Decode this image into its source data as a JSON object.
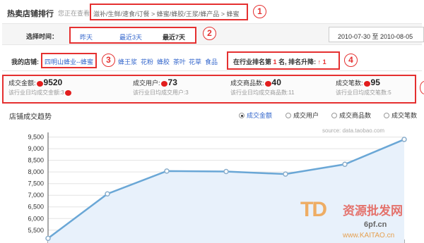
{
  "header": {
    "title": "热卖店铺排行",
    "lead": "您正在查看",
    "breadcrumb": "滋补/生鲜/速食/订餐 > 蜂蜜/蜂胶/王浆/蜂产品 > 蜂蜜"
  },
  "time_bar": {
    "label": "选择时间：",
    "options": [
      "昨天",
      "最近3天",
      "最近7天"
    ],
    "selected": "最近7天",
    "range_text": "2010-07-30 至  2010-08-05"
  },
  "categories": {
    "label": "我的店铺:",
    "shop": "四明山蜂业--蜂蜜",
    "items": [
      "蜂王浆",
      "花粉",
      "蜂胶",
      "茶叶",
      "花草",
      "食品"
    ],
    "rank_prefix": "在行业排名第",
    "rank": "1",
    "rank_mid": "名, 排名升降:",
    "rank_change": "↑ 1"
  },
  "stats": [
    {
      "label": "成交金额:",
      "value": "9520",
      "sub": "该行业日均成交金额:3"
    },
    {
      "label": "成交用户:",
      "value": "73",
      "sub": "该行业日均成交用户:3"
    },
    {
      "label": "成交商品数:",
      "value": "40",
      "sub": "该行业日均成交商品数:11"
    },
    {
      "label": "成交笔数:",
      "value": "95",
      "sub": "该行业日均成交笔数:5"
    }
  ],
  "trend": {
    "title": "店铺成交趋势",
    "options": [
      "成交金额",
      "成交用户",
      "成交商品数",
      "成交笔数"
    ],
    "selected": "成交金额",
    "source": "source: data.taobao.com"
  },
  "annotations": [
    "1",
    "2",
    "3",
    "4"
  ],
  "watermark": {
    "logo": "TD",
    "text": "资源批发网",
    "url1": "6pf.cn",
    "url2": "www.KAITAO.cn"
  },
  "colors": {
    "accent_red": "#e53030",
    "link_blue": "#3366cc",
    "series": "#6aa7d6",
    "fill": "#e8f1fb"
  },
  "chart_data": {
    "type": "area",
    "x": [
      1,
      2,
      3,
      4,
      5,
      6,
      7
    ],
    "series": [
      {
        "values": [
          5150,
          7060,
          8040,
          8020,
          7910,
          8330,
          9400
        ]
      }
    ],
    "yticks": [
      "9,500",
      "9,000",
      "8,500",
      "8,000",
      "7,500",
      "7,000",
      "6,500",
      "6,000",
      "5,500"
    ],
    "ylim": [
      5100,
      9700
    ],
    "grid": true
  }
}
